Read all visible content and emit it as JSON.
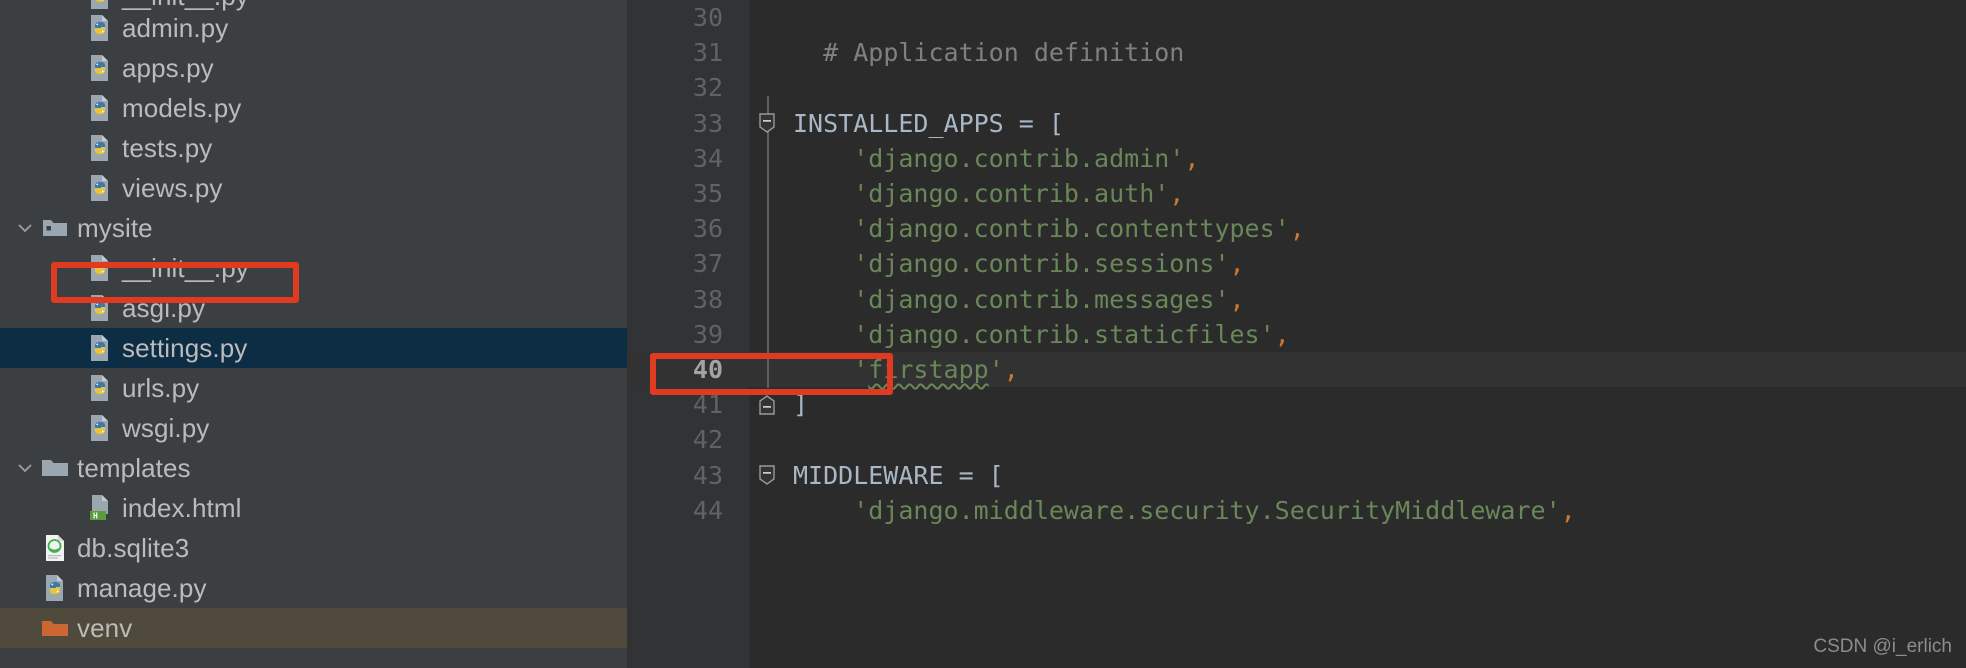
{
  "sidebar": {
    "background_color": "#3c3f41",
    "selection_color": "#0d2d45",
    "excluded_color": "#4f4a3b",
    "items": [
      {
        "label": "__init__.py",
        "icon": "python-file-icon",
        "depth": 2,
        "arrow": "none",
        "state": "normal",
        "clipped_top": true
      },
      {
        "label": "admin.py",
        "icon": "python-file-icon",
        "depth": 2,
        "arrow": "none",
        "state": "normal"
      },
      {
        "label": "apps.py",
        "icon": "python-file-icon",
        "depth": 2,
        "arrow": "none",
        "state": "normal"
      },
      {
        "label": "models.py",
        "icon": "python-file-icon",
        "depth": 2,
        "arrow": "none",
        "state": "normal"
      },
      {
        "label": "tests.py",
        "icon": "python-file-icon",
        "depth": 2,
        "arrow": "none",
        "state": "normal"
      },
      {
        "label": "views.py",
        "icon": "python-file-icon",
        "depth": 2,
        "arrow": "none",
        "state": "normal"
      },
      {
        "label": "mysite",
        "icon": "module-folder-icon",
        "depth": 1,
        "arrow": "expanded",
        "state": "normal"
      },
      {
        "label": "__init__.py",
        "icon": "python-file-icon",
        "depth": 2,
        "arrow": "none",
        "state": "normal"
      },
      {
        "label": "asgi.py",
        "icon": "python-file-icon",
        "depth": 2,
        "arrow": "none",
        "state": "normal"
      },
      {
        "label": "settings.py",
        "icon": "python-file-icon",
        "depth": 2,
        "arrow": "none",
        "state": "selected"
      },
      {
        "label": "urls.py",
        "icon": "python-file-icon",
        "depth": 2,
        "arrow": "none",
        "state": "normal"
      },
      {
        "label": "wsgi.py",
        "icon": "python-file-icon",
        "depth": 2,
        "arrow": "none",
        "state": "normal"
      },
      {
        "label": "templates",
        "icon": "folder-icon",
        "depth": 1,
        "arrow": "expanded",
        "state": "normal"
      },
      {
        "label": "index.html",
        "icon": "html-file-icon",
        "depth": 2,
        "arrow": "none",
        "state": "normal"
      },
      {
        "label": "db.sqlite3",
        "icon": "sqlite-file-icon",
        "depth": 1,
        "arrow": "none",
        "state": "normal"
      },
      {
        "label": "manage.py",
        "icon": "python-file-icon",
        "depth": 1,
        "arrow": "none",
        "state": "normal"
      },
      {
        "label": "venv",
        "icon": "excluded-folder-icon",
        "depth": 1,
        "arrow": "none",
        "state": "excluded"
      }
    ]
  },
  "annotations": {
    "settings_box_color": "#e03a20",
    "firstapp_box_color": "#e03a20"
  },
  "editor": {
    "background_color": "#2b2b2b",
    "gutter_color": "#313335",
    "current_line": 40,
    "lines": [
      {
        "number": "30",
        "fold": "none",
        "current": false,
        "tokens": []
      },
      {
        "number": "31",
        "fold": "none",
        "current": false,
        "tokens": [
          {
            "text": "  ",
            "kind": "plain"
          },
          {
            "text": "# Application definition",
            "kind": "comment"
          }
        ]
      },
      {
        "number": "32",
        "fold": "none",
        "current": false,
        "tokens": []
      },
      {
        "number": "33",
        "fold": "start",
        "current": false,
        "tokens": [
          {
            "text": "INSTALLED_APPS",
            "kind": "const"
          },
          {
            "text": " = ",
            "kind": "plain"
          },
          {
            "text": "[",
            "kind": "bracket"
          }
        ]
      },
      {
        "number": "34",
        "fold": "none",
        "current": false,
        "tokens": [
          {
            "text": "    ",
            "kind": "plain"
          },
          {
            "text": "'django.contrib.admin'",
            "kind": "str"
          },
          {
            "text": ",",
            "kind": "comma"
          }
        ]
      },
      {
        "number": "35",
        "fold": "none",
        "current": false,
        "tokens": [
          {
            "text": "    ",
            "kind": "plain"
          },
          {
            "text": "'django.contrib.auth'",
            "kind": "str"
          },
          {
            "text": ",",
            "kind": "comma"
          }
        ]
      },
      {
        "number": "36",
        "fold": "none",
        "current": false,
        "tokens": [
          {
            "text": "    ",
            "kind": "plain"
          },
          {
            "text": "'django.contrib.contenttypes'",
            "kind": "str"
          },
          {
            "text": ",",
            "kind": "comma"
          }
        ]
      },
      {
        "number": "37",
        "fold": "none",
        "current": false,
        "tokens": [
          {
            "text": "    ",
            "kind": "plain"
          },
          {
            "text": "'django.contrib.sessions'",
            "kind": "str"
          },
          {
            "text": ",",
            "kind": "comma"
          }
        ]
      },
      {
        "number": "38",
        "fold": "none",
        "current": false,
        "tokens": [
          {
            "text": "    ",
            "kind": "plain"
          },
          {
            "text": "'django.contrib.messages'",
            "kind": "str"
          },
          {
            "text": ",",
            "kind": "comma"
          }
        ]
      },
      {
        "number": "39",
        "fold": "none",
        "current": false,
        "tokens": [
          {
            "text": "    ",
            "kind": "plain"
          },
          {
            "text": "'django.contrib.staticfiles'",
            "kind": "str"
          },
          {
            "text": ",",
            "kind": "comma"
          }
        ]
      },
      {
        "number": "40",
        "fold": "none",
        "current": true,
        "tokens": [
          {
            "text": "    ",
            "kind": "plain"
          },
          {
            "text": "'",
            "kind": "str"
          },
          {
            "text": "firstapp",
            "kind": "str",
            "squiggly": true
          },
          {
            "text": "'",
            "kind": "str"
          },
          {
            "text": ",",
            "kind": "comma"
          }
        ]
      },
      {
        "number": "41",
        "fold": "end",
        "current": false,
        "tokens": [
          {
            "text": "]",
            "kind": "bracket"
          }
        ]
      },
      {
        "number": "42",
        "fold": "none",
        "current": false,
        "tokens": []
      },
      {
        "number": "43",
        "fold": "start",
        "current": false,
        "tokens": [
          {
            "text": "MIDDLEWARE",
            "kind": "const"
          },
          {
            "text": " = ",
            "kind": "plain"
          },
          {
            "text": "[",
            "kind": "bracket"
          }
        ]
      },
      {
        "number": "44",
        "fold": "none",
        "current": false,
        "tokens": [
          {
            "text": "    ",
            "kind": "plain"
          },
          {
            "text": "'django.middleware.security.SecurityMiddleware'",
            "kind": "str"
          },
          {
            "text": ",",
            "kind": "comma"
          }
        ]
      }
    ]
  },
  "watermark": {
    "text": "CSDN @i_erlich"
  }
}
